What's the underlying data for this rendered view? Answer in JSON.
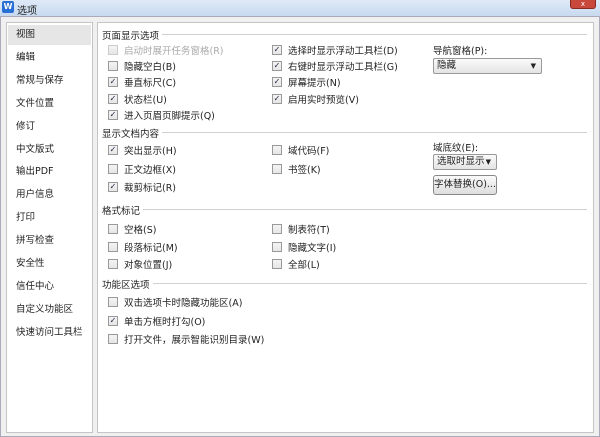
{
  "window": {
    "title": "选项",
    "close": "x",
    "app_icon": "W"
  },
  "sidebar": {
    "items": [
      "视图",
      "编辑",
      "常规与保存",
      "文件位置",
      "修订",
      "中文版式",
      "输出PDF",
      "用户信息",
      "打印",
      "拼写检查",
      "安全性",
      "信任中心",
      "自定义功能区",
      "快速访问工具栏"
    ],
    "selected": 0
  },
  "sections": {
    "page_display": {
      "title": "页面显示选项",
      "left": [
        {
          "label": "启动时展开任务窗格(R)",
          "checked": false,
          "disabled": true
        },
        {
          "label": "隐藏空白(B)",
          "checked": false
        },
        {
          "label": "垂直标尺(C)",
          "checked": true
        },
        {
          "label": "状态栏(U)",
          "checked": true
        },
        {
          "label": "进入页眉页脚提示(Q)",
          "checked": true
        }
      ],
      "right": [
        {
          "label": "选择时显示浮动工具栏(D)",
          "checked": true
        },
        {
          "label": "右键时显示浮动工具栏(G)",
          "checked": true
        },
        {
          "label": "屏幕提示(N)",
          "checked": true
        },
        {
          "label": "启用实时预览(V)",
          "checked": true
        }
      ],
      "nav_label": "导航窗格(P):",
      "nav_value": "隐藏"
    },
    "doc_content": {
      "title": "显示文档内容",
      "left": [
        {
          "label": "突出显示(H)",
          "checked": true
        },
        {
          "label": "正文边框(X)",
          "checked": false
        },
        {
          "label": "裁剪标记(R)",
          "checked": true
        }
      ],
      "right": [
        {
          "label": "域代码(F)",
          "checked": false
        },
        {
          "label": "书签(K)",
          "checked": false
        }
      ],
      "shading_label": "域底纹(E):",
      "shading_value": "选取时显示",
      "font_button": "字体替换(O)..."
    },
    "format_marks": {
      "title": "格式标记",
      "left": [
        {
          "label": "空格(S)",
          "checked": false
        },
        {
          "label": "段落标记(M)",
          "checked": false
        },
        {
          "label": "对象位置(J)",
          "checked": false
        }
      ],
      "right": [
        {
          "label": "制表符(T)",
          "checked": false
        },
        {
          "label": "隐藏文字(I)",
          "checked": false
        },
        {
          "label": "全部(L)",
          "checked": false
        }
      ]
    },
    "ribbon": {
      "title": "功能区选项",
      "left": [
        {
          "label": "双击选项卡时隐藏功能区(A)",
          "checked": false
        },
        {
          "label": "单击方框时打勾(O)",
          "checked": true
        },
        {
          "label": "打开文件，展示智能识别目录(W)",
          "checked": false
        }
      ]
    }
  }
}
